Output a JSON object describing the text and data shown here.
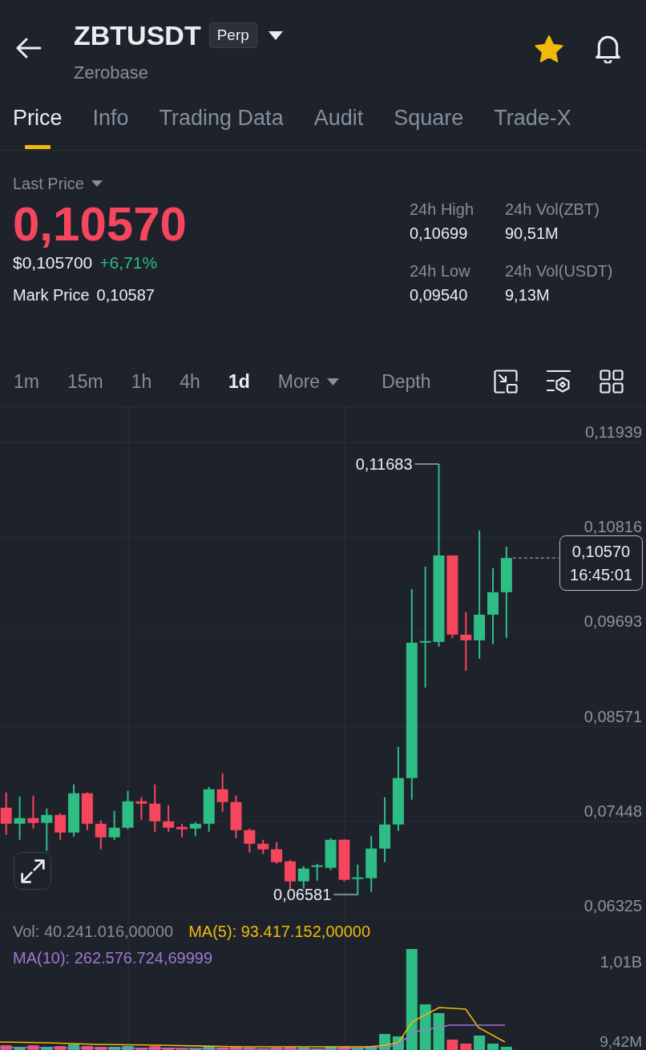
{
  "header": {
    "symbol": "ZBTUSDT",
    "contract_badge": "Perp",
    "name": "Zerobase",
    "favorite": true
  },
  "tabs": [
    {
      "label": "Price",
      "selected": true
    },
    {
      "label": "Info",
      "selected": false
    },
    {
      "label": "Trading Data",
      "selected": false
    },
    {
      "label": "Audit",
      "selected": false
    },
    {
      "label": "Square",
      "selected": false
    },
    {
      "label": "Trade-X",
      "selected": false
    }
  ],
  "ticker": {
    "price_source": "Last Price",
    "last_price": "0,10570",
    "last_price_falling": true,
    "usd_price": "$0,105700",
    "change": "+6,71%",
    "change_positive": true,
    "mark_price_label": "Mark Price",
    "mark_price": "0,10587"
  },
  "stats": [
    {
      "label": "24h High",
      "value": "0,10699"
    },
    {
      "label": "24h Vol(ZBT)",
      "value": "90,51M"
    },
    {
      "label": "24h Low",
      "value": "0,09540"
    },
    {
      "label": "24h Vol(USDT)",
      "value": "9,13M"
    }
  ],
  "intervals": [
    {
      "label": "1m",
      "kind": "interval",
      "selected": false
    },
    {
      "label": "15m",
      "kind": "interval",
      "selected": false
    },
    {
      "label": "1h",
      "kind": "interval",
      "selected": false
    },
    {
      "label": "4h",
      "kind": "interval",
      "selected": false
    },
    {
      "label": "1d",
      "kind": "interval",
      "selected": true
    },
    {
      "label": "More",
      "kind": "dropdown",
      "selected": false
    },
    {
      "label": "Depth",
      "kind": "view",
      "selected": false
    }
  ],
  "chart": {
    "chart_data": {
      "type": "candlestick",
      "grid": true,
      "ohlc": [
        [
          0.0761,
          0.07791,
          0.07287,
          0.0742
        ],
        [
          0.0742,
          0.07743,
          0.0723,
          0.07487
        ],
        [
          0.07487,
          0.07753,
          0.07363,
          0.0743
        ],
        [
          0.0743,
          0.07601,
          0.07098,
          0.07525
        ],
        [
          0.07525,
          0.07544,
          0.0723,
          0.07316
        ],
        [
          0.07316,
          0.07886,
          0.07268,
          0.07781
        ],
        [
          0.07781,
          0.07791,
          0.07344,
          0.0742
        ],
        [
          0.0742,
          0.07458,
          0.07117,
          0.07259
        ],
        [
          0.07259,
          0.07572,
          0.0723,
          0.07373
        ],
        [
          0.07373,
          0.0781,
          0.07354,
          0.07686
        ],
        [
          0.07686,
          0.07734,
          0.07468,
          0.07658
        ],
        [
          0.07658,
          0.07886,
          0.07325,
          0.07449
        ],
        [
          0.07449,
          0.07639,
          0.07325,
          0.07373
        ],
        [
          0.07382,
          0.0742,
          0.07259,
          0.07354
        ],
        [
          0.07363,
          0.07439,
          0.07278,
          0.0742
        ],
        [
          0.0742,
          0.07857,
          0.07325,
          0.07829
        ],
        [
          0.07829,
          0.08018,
          0.07563,
          0.07677
        ],
        [
          0.07677,
          0.07753,
          0.07249,
          0.07344
        ],
        [
          0.07344,
          0.07363,
          0.07079,
          0.07183
        ],
        [
          0.07183,
          0.0723,
          0.0706,
          0.07117
        ],
        [
          0.07117,
          0.07202,
          0.06946,
          0.06965
        ],
        [
          0.06974,
          0.06993,
          0.06651,
          0.06737
        ],
        [
          0.06737,
          0.06917,
          0.06651,
          0.06889
        ],
        [
          0.06908,
          0.06946,
          0.06746,
          0.06927
        ],
        [
          0.06898,
          0.07249,
          0.0687,
          0.0723
        ],
        [
          0.0723,
          0.0724,
          0.06737,
          0.06756
        ],
        [
          0.06765,
          0.06936,
          0.06581,
          0.06784
        ],
        [
          0.06775,
          0.07278,
          0.06613,
          0.07126
        ],
        [
          0.07126,
          0.07734,
          0.06965,
          0.07411
        ],
        [
          0.07411,
          0.08332,
          0.07335,
          0.07961
        ],
        [
          0.07961,
          0.10202,
          0.07705,
          0.09566
        ],
        [
          0.09566,
          0.10468,
          0.09034,
          0.09585
        ],
        [
          0.09575,
          0.11683,
          0.09518,
          0.106
        ],
        [
          0.106,
          0.106,
          0.09623,
          0.09661
        ],
        [
          0.09661,
          0.09927,
          0.09234,
          0.09594
        ],
        [
          0.09594,
          0.10895,
          0.09376,
          0.09898
        ],
        [
          0.09898,
          0.10449,
          0.09547,
          0.10164
        ],
        [
          0.10164,
          0.10705,
          0.09623,
          0.1057
        ]
      ],
      "ylim": [
        0.06325,
        0.12357
      ],
      "yticks": [
        {
          "value": 0.11939,
          "label": "0,11939"
        },
        {
          "value": 0.10816,
          "label": "0,10816"
        },
        {
          "value": 0.09693,
          "label": "0,09693"
        },
        {
          "value": 0.08571,
          "label": "0,08571"
        },
        {
          "value": 0.07448,
          "label": "0,07448"
        },
        {
          "value": 0.06325,
          "label": "0,06325"
        }
      ],
      "annotations": [
        "0,11683",
        "0,06581"
      ]
    },
    "price_tag": {
      "price": "0,10570",
      "countdown": "16:45:01"
    }
  },
  "volume": {
    "legend": [
      {
        "text": "Vol: 40.241.016,00000",
        "color": "#848e9c"
      },
      {
        "text": "MA(5): 93.417.152,00000",
        "color": "#f0b90b"
      },
      {
        "text": "MA(10): 262.576.724,69999",
        "color": "#9c7ad2"
      }
    ],
    "axis": [
      "1,01B",
      "9,42M"
    ]
  }
}
